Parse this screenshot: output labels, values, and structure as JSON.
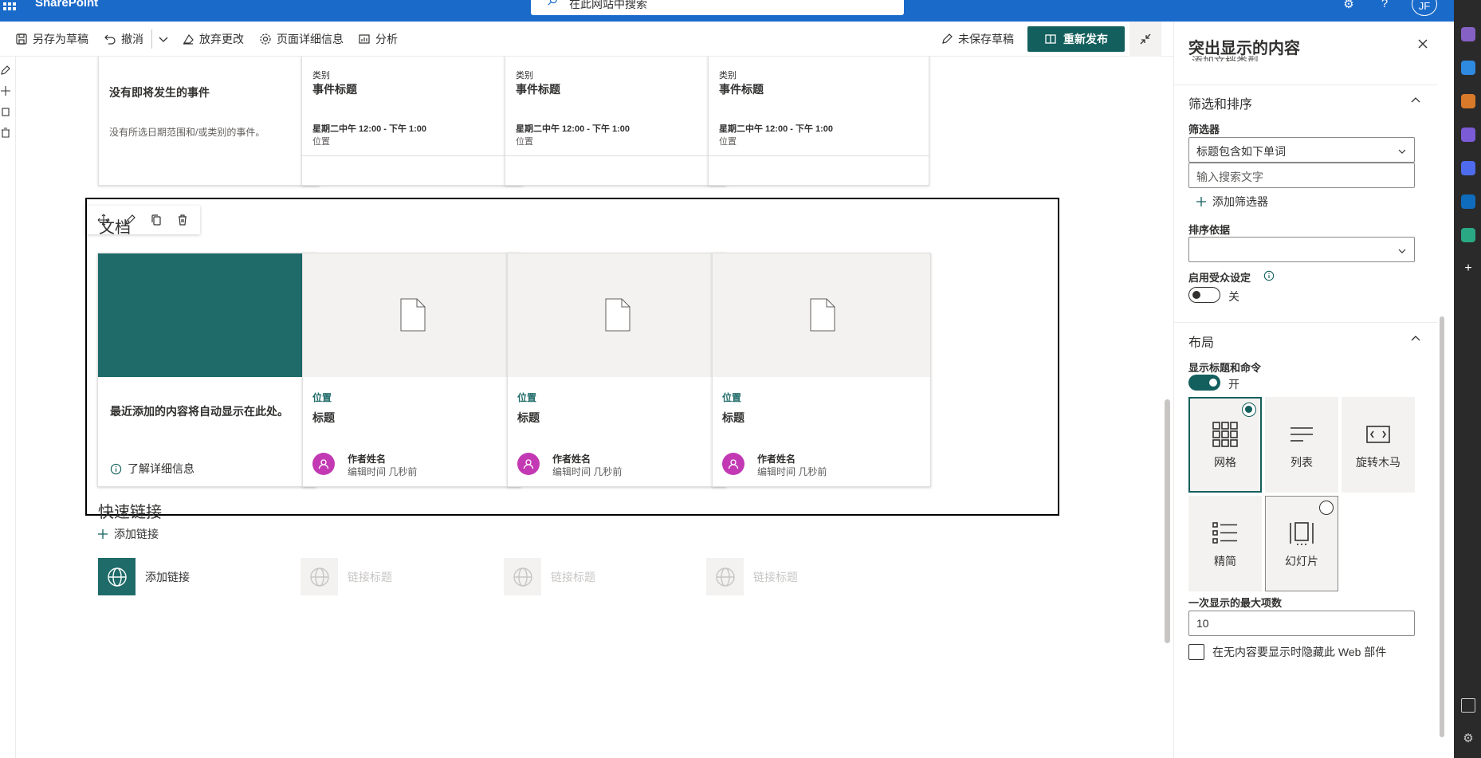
{
  "suite": {
    "brand": "SharePoint",
    "search_placeholder": "在此网站中搜索",
    "avatar_initials": "JF"
  },
  "commands": {
    "save_draft": "另存为草稿",
    "undo": "撤消",
    "discard": "放弃更改",
    "page_details": "页面详细信息",
    "analytics": "分析",
    "unsaved_draft": "未保存草稿",
    "republish": "重新发布"
  },
  "events": {
    "empty_title": "没有即将发生的事件",
    "empty_desc": "没有所选日期范围和/或类别的事件。",
    "cards": [
      {
        "category": "类别",
        "title": "事件标题",
        "time": "星期二中午 12:00 - 下午 1:00",
        "location": "位置"
      },
      {
        "category": "类别",
        "title": "事件标题",
        "time": "星期二中午 12:00 - 下午 1:00",
        "location": "位置"
      },
      {
        "category": "类别",
        "title": "事件标题",
        "time": "星期二中午 12:00 - 下午 1:00",
        "location": "位置"
      }
    ]
  },
  "documents": {
    "title": "文档",
    "recent_text": "最近添加的内容将自动显示在此处。",
    "learn_more": "了解详细信息",
    "cards": [
      {
        "location": "位置",
        "title": "标题",
        "author": "作者姓名",
        "edited": "编辑时间 几秒前"
      },
      {
        "location": "位置",
        "title": "标题",
        "author": "作者姓名",
        "edited": "编辑时间 几秒前"
      },
      {
        "location": "位置",
        "title": "标题",
        "author": "作者姓名",
        "edited": "编辑时间 几秒前"
      }
    ]
  },
  "quick_links": {
    "title": "快速链接",
    "add_link": "添加链接",
    "items": [
      {
        "label": "添加链接"
      },
      {
        "label": "链接标题"
      },
      {
        "label": "链接标题"
      },
      {
        "label": "链接标题"
      }
    ]
  },
  "pane": {
    "title": "突出显示的内容",
    "partial_text": "添加文档类型",
    "filter_sort_section": "筛选和排序",
    "filter_label": "筛选器",
    "filter_value": "标题包含如下单词",
    "search_placeholder": "输入搜索文字",
    "add_filter": "添加筛选器",
    "sort_label": "排序依据",
    "sort_value": "",
    "audience_label": "启用受众设定",
    "audience_state": "关",
    "layout_section": "布局",
    "show_title_label": "显示标题和命令",
    "show_title_state": "开",
    "layouts": [
      "网格",
      "列表",
      "旋转木马",
      "精简",
      "幻灯片"
    ],
    "selected_layout": "网格",
    "max_items_label": "一次显示的最大项数",
    "max_items_value": "10",
    "hide_checkbox": "在无内容要显示时隐藏此 Web 部件"
  },
  "colors": {
    "suite_blue": "#1a6aca",
    "theme_teal": "#135f5d",
    "avatar_magenta": "#c239b3"
  }
}
